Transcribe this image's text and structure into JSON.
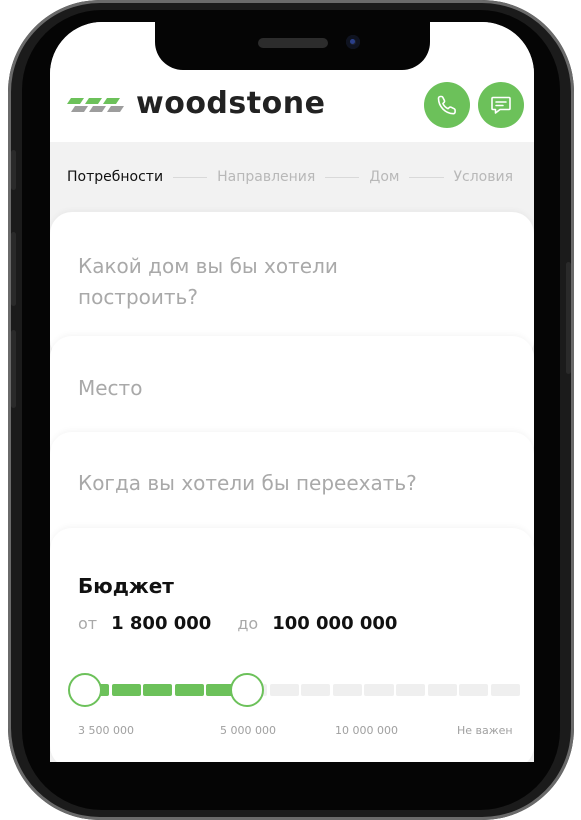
{
  "brand": {
    "name": "woodstone"
  },
  "header": {
    "phone_icon": "phone-icon",
    "chat_icon": "chat-icon",
    "accent": "#6cc15a"
  },
  "steps": [
    {
      "label": "Потребности",
      "active": true
    },
    {
      "label": "Направления",
      "active": false
    },
    {
      "label": "Дом",
      "active": false
    },
    {
      "label": "Условия",
      "active": false
    }
  ],
  "questions": {
    "house": "Какой дом вы бы хотели построить?",
    "place": "Место",
    "move": "Когда вы хотели бы переехать?"
  },
  "budget": {
    "title": "Бюджет",
    "from_label": "от",
    "from_value": "1 800 000",
    "to_label": "до",
    "to_value": "100 000 000",
    "ticks": [
      "3 500 000",
      "5 000 000",
      "10 000 000",
      "Не важен"
    ],
    "selected_range": [
      0,
      0.38
    ]
  }
}
